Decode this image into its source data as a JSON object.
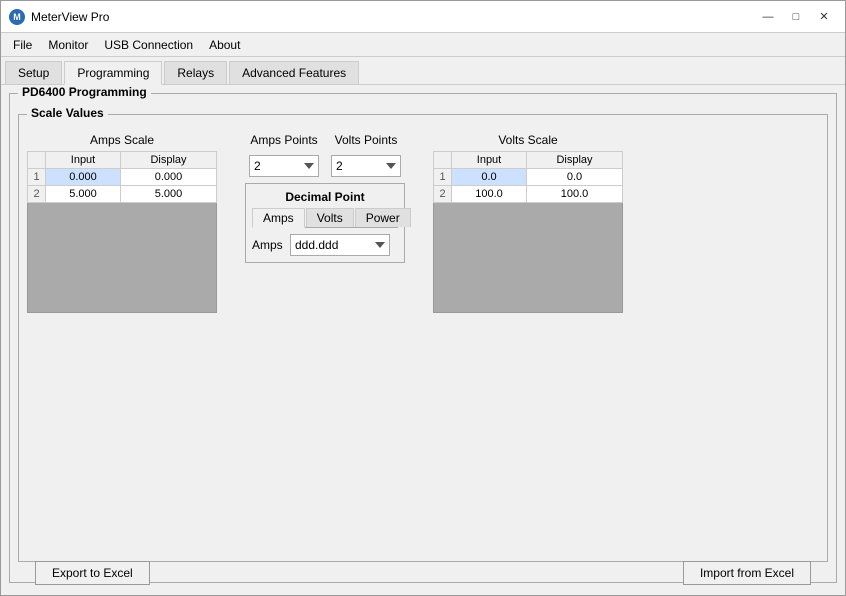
{
  "window": {
    "title": "MeterView Pro",
    "controls": {
      "minimize": "—",
      "maximize": "□",
      "close": "✕"
    }
  },
  "menu": {
    "items": [
      "File",
      "Monitor",
      "USB Connection",
      "About"
    ]
  },
  "tabs": {
    "items": [
      "Setup",
      "Programming",
      "Relays",
      "Advanced Features"
    ],
    "active": "Programming"
  },
  "programming": {
    "group_title": "PD6400 Programming",
    "scale_values_title": "Scale Values",
    "amps_scale_label": "Amps Scale",
    "amps_points_label": "Amps Points",
    "volts_points_label": "Volts Points",
    "volts_scale_label": "Volts Scale",
    "amps_table": {
      "headers": [
        "",
        "Input",
        "Display"
      ],
      "rows": [
        {
          "num": "1",
          "input": "0.000",
          "display": "0.000"
        },
        {
          "num": "2",
          "input": "5.000",
          "display": "5.000"
        }
      ]
    },
    "volts_table": {
      "headers": [
        "",
        "Input",
        "Display"
      ],
      "rows": [
        {
          "num": "1",
          "input": "0.0",
          "display": "0.0"
        },
        {
          "num": "2",
          "input": "100.0",
          "display": "100.0"
        }
      ]
    },
    "amps_points_value": "2",
    "volts_points_value": "2",
    "decimal_point": {
      "title": "Decimal Point",
      "tabs": [
        "Amps",
        "Volts",
        "Power"
      ],
      "active_tab": "Amps",
      "amps_label": "Amps",
      "amps_value": "ddd.ddd"
    },
    "export_button": "Export to Excel",
    "import_button": "Import from Excel"
  }
}
